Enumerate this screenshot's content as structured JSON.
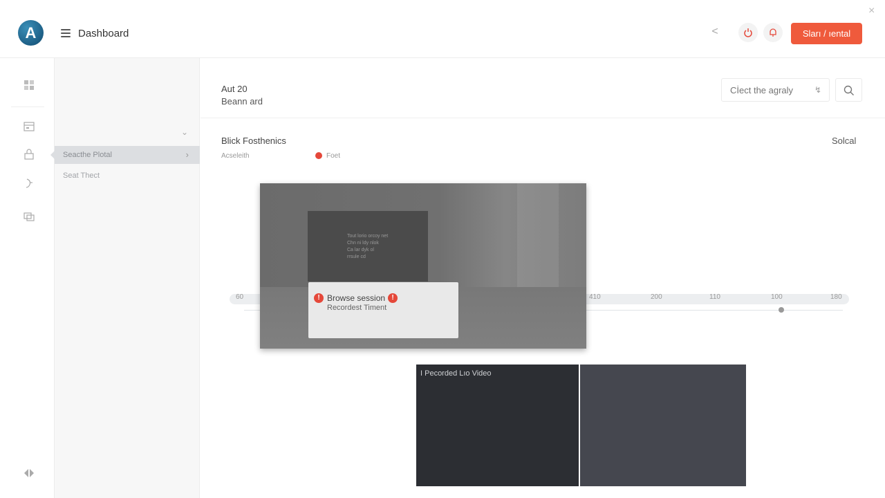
{
  "header": {
    "logo_letter": "A",
    "title": "Dashboard",
    "cta_label": "Sları / ıental",
    "close_symbol": "×",
    "back_symbol": "<"
  },
  "sidebar": {
    "active_item": "Seacthe Plotal",
    "second_item": "Seat Thect"
  },
  "main": {
    "line1": "Aut 20",
    "line2": "Beann ard",
    "search_placeholder": "Cİect the agraly",
    "section_title": "Blick Fosthenics",
    "section_right": "Solcal",
    "legend_left": "Acseleith",
    "legend_right": "Foet",
    "ticks": [
      "60",
      "410",
      "200",
      "110",
      "100",
      "180"
    ],
    "monitor_text": [
      "Tout lorio orcoy net",
      "Chn ni ldy nlok",
      "Ca lar dyk ol",
      "rrsule cd"
    ],
    "popup_line1": "Browse session",
    "popup_line2": "Recordest Timent",
    "badge_symbol": "!",
    "panel_label": "I Pecorded Lıo Video"
  },
  "colors": {
    "accent": "#ef5a3c",
    "badge": "#e5483a",
    "logo": "#1d5f86"
  }
}
